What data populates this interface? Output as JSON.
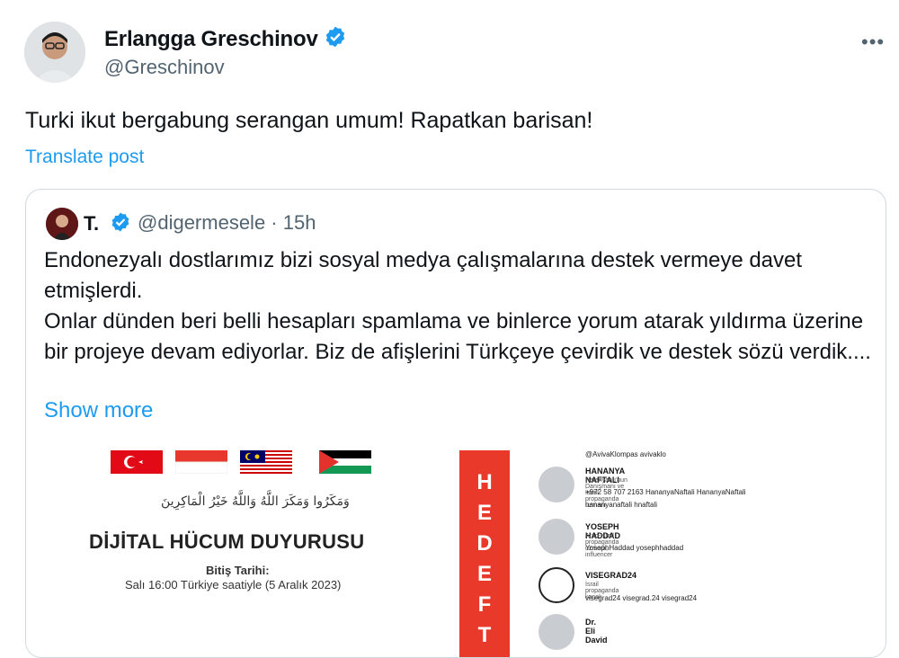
{
  "post": {
    "author_name": "Erlangga Greschinov",
    "author_handle": "@Greschinov",
    "text": "Turki ikut bergabung serangan umum! Rapatkan barisan!",
    "translate_label": "Translate post",
    "more_label": "•••"
  },
  "quote": {
    "name": "T.",
    "handle_time": "@digermesele · 15h",
    "paragraph1": "Endonezyalı dostlarımız bizi sosyal medya çalışmalarına destek vermeye davet etmişlerdi.",
    "paragraph2": "Onlar dünden beri belli hesapları spamlama ve binlerce yorum atarak yıldırma üzerine bir projeye devam ediyorlar. Biz de afişlerini Türkçeye çevirdik ve destek sözü verdik....",
    "show_more": "Show more"
  },
  "media_left": {
    "arabic_line": "وَمَكَرُوا وَمَكَرَ اللَّهُ وَاللَّهُ خَيْرُ الْمَاكِرِينَ",
    "title": "DİJİTAL HÜCUM DUYURUSU",
    "deadline_label": "Bitiş Tarihi:",
    "deadline_value": "Salı 16:00 Türkiye saatiyle (5 Aralık 2023)"
  },
  "media_right": {
    "banner_letters": [
      "H",
      "E",
      "D",
      "E",
      "F",
      "T"
    ],
    "top_social": "@AvivaKlompas   avivaklo",
    "targets": [
      {
        "name": "HANANYA NAFTALI",
        "role": "Netanyahu'nun Danışmanı ve İsrail propaganda uzmanı",
        "social1": "+972 58 707 2163   HananyaNaftali   HananyaNaftali",
        "social2": "hananyanaftali   hnaftali"
      },
      {
        "name": "YOSEPH HADDAD",
        "role": "Arap-İsrail propaganda uzmanı, influencer",
        "social1": "YosephHaddad   yosephhaddad",
        "social2": ""
      },
      {
        "name": "VISEGRAD24",
        "role": "İsrail propaganda kanalı",
        "social1": "visegrad24   visegrad.24   visegrad24",
        "social2": ""
      },
      {
        "name": "Dr. Eli David",
        "role": "",
        "social1": "",
        "social2": ""
      }
    ]
  },
  "colors": {
    "accent": "#1d9bf0",
    "banner_red": "#e8392b"
  }
}
